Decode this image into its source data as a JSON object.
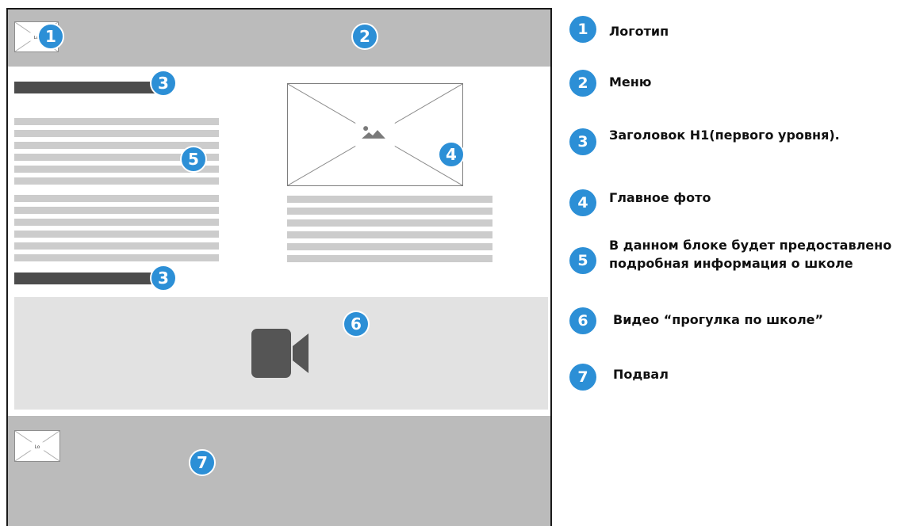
{
  "logo_text": "Lo",
  "badges": {
    "logo": "1",
    "menu": "2",
    "heading_top": "3",
    "heading_bottom": "3",
    "photo": "4",
    "info": "5",
    "video": "6",
    "footer": "7"
  },
  "legend": [
    {
      "number": "1",
      "label": "Логотип"
    },
    {
      "number": "2",
      "label": "Меню"
    },
    {
      "number": "3",
      "label": "Заголовок H1(первого уровня)."
    },
    {
      "number": "4",
      "label": "Главное фото"
    },
    {
      "number": "5",
      "line1": "В данном блоке будет предоставлено",
      "line2": "подробная информация о  школе"
    },
    {
      "number": "6",
      "label": "Видео “прогулка по школе”"
    },
    {
      "number": "7",
      "label": "Подвал"
    }
  ],
  "colors": {
    "accent": "#2c8fd6",
    "bands": "#bbbbbb",
    "video_band": "#e2e2e2",
    "heading_bar": "#4c4c4c",
    "text_lines": "#cccccc"
  },
  "icons": [
    "image-placeholder-icon",
    "video-camera-icon"
  ]
}
